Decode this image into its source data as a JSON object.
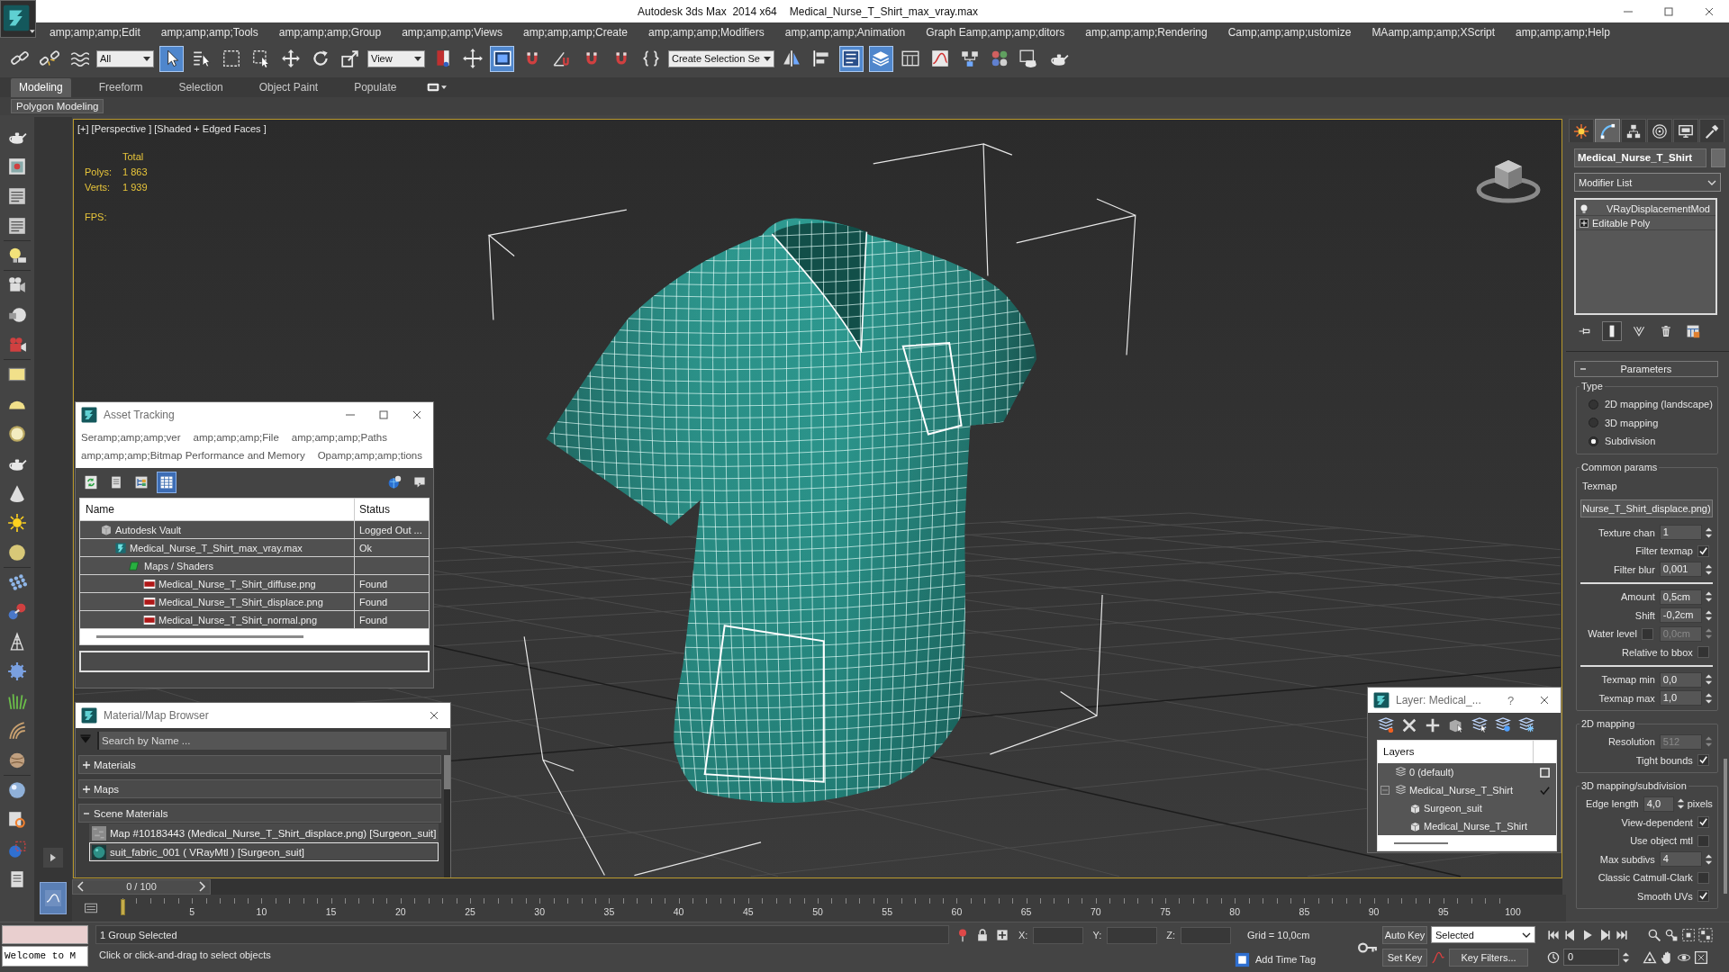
{
  "window": {
    "title": "Autodesk 3ds Max  2014 x64",
    "document": "Medical_Nurse_T_Shirt_max_vray.max"
  },
  "menu": [
    "amp;amp;amp;Edit",
    "amp;amp;amp;Tools",
    "amp;amp;amp;Group",
    "amp;amp;amp;Views",
    "amp;amp;amp;Create",
    "amp;amp;amp;Modifiers",
    "amp;amp;amp;Animation",
    "Graph Eamp;amp;amp;ditors",
    "amp;amp;amp;Rendering",
    "Camp;amp;amp;ustomize",
    "MAamp;amp;amp;XScript",
    "amp;amp;amp;Help"
  ],
  "toolbar": [
    {
      "kind": "button",
      "active": false
    },
    {
      "kind": "button",
      "active": false
    },
    {
      "kind": "button",
      "active": false
    },
    {
      "kind": "dropdown",
      "value": "All"
    },
    {
      "kind": "button",
      "active": true
    },
    {
      "kind": "button",
      "active": false
    },
    {
      "kind": "button",
      "active": false
    },
    {
      "kind": "button",
      "active": false
    },
    {
      "kind": "button",
      "active": false
    },
    {
      "kind": "button",
      "active": false
    },
    {
      "kind": "button",
      "active": false
    },
    {
      "kind": "dropdown",
      "value": "View"
    },
    {
      "kind": "button",
      "active": false
    },
    {
      "kind": "button",
      "active": false
    },
    {
      "kind": "button",
      "active": true
    },
    {
      "kind": "button",
      "active": false
    },
    {
      "kind": "button",
      "active": false
    },
    {
      "kind": "button",
      "active": false
    },
    {
      "kind": "button",
      "active": false
    },
    {
      "kind": "button",
      "active": false
    },
    {
      "kind": "dropdown",
      "value": "Create Selection Se"
    },
    {
      "kind": "button",
      "active": false
    },
    {
      "kind": "button",
      "active": false
    },
    {
      "kind": "button",
      "active": true
    },
    {
      "kind": "button",
      "active": true
    },
    {
      "kind": "button",
      "active": false
    },
    {
      "kind": "button",
      "active": false
    },
    {
      "kind": "button",
      "active": false
    },
    {
      "kind": "button",
      "active": false
    },
    {
      "kind": "button",
      "active": false
    },
    {
      "kind": "button",
      "active": false
    }
  ],
  "ribbon": {
    "tabs": [
      {
        "label": "Modeling",
        "selected": true
      },
      {
        "label": "Freeform",
        "selected": false
      },
      {
        "label": "Selection",
        "selected": false
      },
      {
        "label": "Object Paint",
        "selected": false
      },
      {
        "label": "Populate",
        "selected": false
      }
    ],
    "panel": "Polygon Modeling"
  },
  "viewport": {
    "label": "[+] [Perspective ] [Shaded + Edged Faces ]",
    "stats": {
      "header": "Total",
      "rows": [
        {
          "label": "Polys:",
          "value": "1 863"
        },
        {
          "label": "Verts:",
          "value": "1 939"
        }
      ],
      "fps_label": "FPS:"
    }
  },
  "asset_tracking": {
    "title": "Asset Tracking",
    "menu": [
      "Seramp;amp;amp;ver",
      "amp;amp;amp;File",
      "amp;amp;amp;Paths",
      "amp;amp;amp;Bitmap Performance and Memory",
      "Opamp;amp;amp;tions"
    ],
    "tools": [
      {
        "active": false
      },
      {
        "active": false
      },
      {
        "active": false
      },
      {
        "active": true
      }
    ],
    "columns": [
      "Name",
      "Status"
    ],
    "rows": [
      {
        "kind": "vault",
        "name": "Autodesk Vault",
        "status": "Logged Out ...",
        "children": [
          {
            "kind": "scene",
            "name": "Medical_Nurse_T_Shirt_max_vray.max",
            "status": "Ok",
            "children": [
              {
                "kind": "folder",
                "name": "Maps / Shaders",
                "children": [
                  {
                    "kind": "png",
                    "name": "Medical_Nurse_T_Shirt_diffuse.png",
                    "status": "Found"
                  },
                  {
                    "kind": "png",
                    "name": "Medical_Nurse_T_Shirt_displace.png",
                    "status": "Found"
                  },
                  {
                    "kind": "png",
                    "name": "Medical_Nurse_T_Shirt_normal.png",
                    "status": "Found"
                  }
                ]
              }
            ]
          }
        ]
      }
    ]
  },
  "material_browser": {
    "title": "Material/Map Browser",
    "search": {
      "placeholder": "Search by Name ..."
    },
    "groups": [
      {
        "label": "Materials",
        "expanded": false
      },
      {
        "label": "Maps",
        "expanded": false
      },
      {
        "label": "Scene Materials",
        "expanded": true,
        "items": [
          {
            "kind": "map",
            "label": "Map #10183443 (Medical_Nurse_T_Shirt_displace.png) [Surgeon_suit]",
            "selected": false
          },
          {
            "kind": "material",
            "label": "suit_fabric_001 ( VRayMtl ) [Surgeon_suit]",
            "selected": true
          }
        ]
      }
    ]
  },
  "layer_dialog": {
    "title": "Layer: Medical_...",
    "help": "?",
    "columns": [
      "Layers"
    ],
    "rows": [
      {
        "kind": "layer",
        "name": "0 (default)",
        "current": false
      },
      {
        "kind": "layer",
        "name": "Medical_Nurse_T_Shirt",
        "current": true,
        "expanded": true,
        "children": [
          {
            "kind": "object",
            "name": "Surgeon_suit"
          },
          {
            "kind": "object",
            "name": "Medical_Nurse_T_Shirt"
          }
        ]
      }
    ]
  },
  "command_panel": {
    "tabs": [
      {
        "selected": false
      },
      {
        "selected": true
      },
      {
        "selected": false
      },
      {
        "selected": false
      },
      {
        "selected": false
      },
      {
        "selected": false
      }
    ],
    "object_name": "Medical_Nurse_T_Shirt",
    "modifier_list": "Modifier List",
    "stack": [
      {
        "kind": "modifier",
        "name": "VRayDisplacementMod"
      },
      {
        "kind": "object",
        "name": "Editable Poly"
      }
    ],
    "stack_tools": [
      {
        "active": false
      },
      {
        "active": true
      },
      {
        "active": false
      },
      {
        "active": false
      },
      {
        "active": false
      }
    ],
    "rollout": {
      "title": "Parameters",
      "expanded": true,
      "groups": [
        {
          "title": "Type",
          "rows": [
            {
              "kind": "radio",
              "label": "2D mapping (landscape)",
              "selected": false
            },
            {
              "kind": "radio",
              "label": "3D mapping",
              "selected": false
            },
            {
              "kind": "radio",
              "label": "Subdivision",
              "selected": true
            }
          ]
        },
        {
          "title": "Common params",
          "rows": [
            {
              "kind": "caption",
              "label": "Texmap"
            },
            {
              "kind": "button",
              "label": "Nurse_T_Shirt_displace.png)"
            },
            {
              "kind": "spinner",
              "label": "Texture chan",
              "value": "1",
              "disabled": false
            },
            {
              "kind": "check",
              "label": "Filter texmap",
              "checked": true
            },
            {
              "kind": "spinner",
              "label": "Filter blur",
              "value": "0,001",
              "disabled": false
            },
            {
              "kind": "rule"
            },
            {
              "kind": "spinner",
              "label": "Amount",
              "value": "0,5cm",
              "disabled": false
            },
            {
              "kind": "spinner",
              "label": "Shift",
              "value": "-0,2cm",
              "disabled": false
            },
            {
              "kind": "check-spinner",
              "label": "Water level",
              "checked": false,
              "value": "0,0cm",
              "disabled": true
            },
            {
              "kind": "check",
              "label": "Relative to bbox",
              "checked": false
            },
            {
              "kind": "rule"
            },
            {
              "kind": "spinner",
              "label": "Texmap min",
              "value": "0,0",
              "disabled": false
            },
            {
              "kind": "spinner",
              "label": "Texmap max",
              "value": "1,0",
              "disabled": false
            }
          ]
        },
        {
          "title": "2D mapping",
          "rows": [
            {
              "kind": "spinner",
              "label": "Resolution",
              "value": "512",
              "disabled": true
            },
            {
              "kind": "check",
              "label": "Tight bounds",
              "checked": true
            }
          ]
        },
        {
          "title": "3D mapping/subdivision",
          "rows": [
            {
              "kind": "spinner",
              "label": "Edge length",
              "value": "4,0",
              "unit": "pixels",
              "disabled": false
            },
            {
              "kind": "check",
              "label": "View-dependent",
              "checked": true
            },
            {
              "kind": "check",
              "label": "Use object mtl",
              "checked": false
            },
            {
              "kind": "spinner",
              "label": "Max subdivs",
              "value": "4",
              "disabled": false
            },
            {
              "kind": "check",
              "label": "Classic Catmull-Clark",
              "checked": false
            },
            {
              "kind": "check",
              "label": "Smooth UVs",
              "checked": true
            }
          ]
        }
      ]
    }
  },
  "timeline": {
    "time_slider": {
      "label": "0 / 100",
      "level": 0
    },
    "ticks": [
      "5",
      "10",
      "15",
      "20",
      "25",
      "30",
      "35",
      "40",
      "45",
      "50",
      "55",
      "60",
      "65",
      "70",
      "75",
      "80",
      "85",
      "90",
      "95",
      "100"
    ]
  },
  "listener": "Welcome to M",
  "status": {
    "selection": "1 Group Selected",
    "prompt": "Click or click-and-drag to select objects",
    "coords": [
      "X:",
      "Y:",
      "Z:"
    ],
    "grid": "Grid = 10,0cm",
    "time_tag": "Add Time Tag"
  },
  "animation": {
    "auto_key": "Auto Key",
    "key_mode": "Selected",
    "set_key": "Set Key",
    "key_filters": "Key Filters...",
    "frame": "0"
  }
}
